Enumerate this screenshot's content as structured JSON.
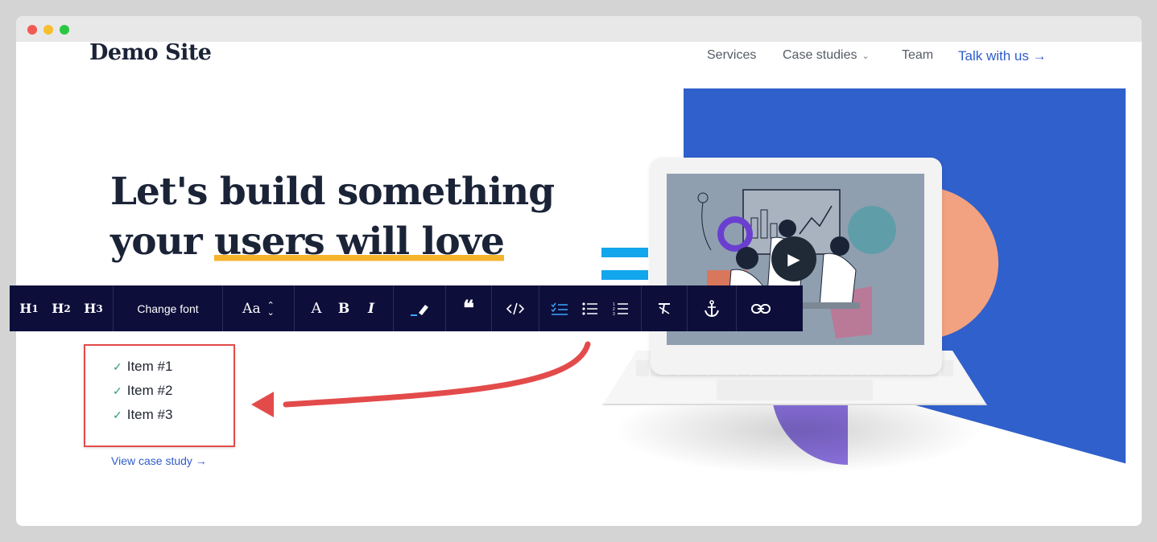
{
  "header": {
    "logo": "Demo Site",
    "nav": {
      "services": "Services",
      "case_studies": "Case studies",
      "team": "Team",
      "talk": "Talk with us →"
    }
  },
  "hero": {
    "line1": "Let's build something",
    "line2_prefix": "your ",
    "line2_highlight": "users will love",
    "list_items": [
      "Item #1",
      "Item #2",
      "Item #3"
    ],
    "view_link": "View case study →"
  },
  "toolbar": {
    "h1": "H",
    "h1_sub": "1",
    "h2": "H",
    "h2_sub": "2",
    "h3": "H",
    "h3_sub": "3",
    "change_font": "Change font",
    "font_size": "Aa",
    "text_color": "A",
    "bold": "B",
    "italic": "I"
  },
  "colors": {
    "accent_blue": "#3060cc",
    "toolbar_bg": "#0d0e3a",
    "highlight": "#f6b42c",
    "annotation_red": "#e34b4b",
    "check_green": "#2fa36b"
  }
}
